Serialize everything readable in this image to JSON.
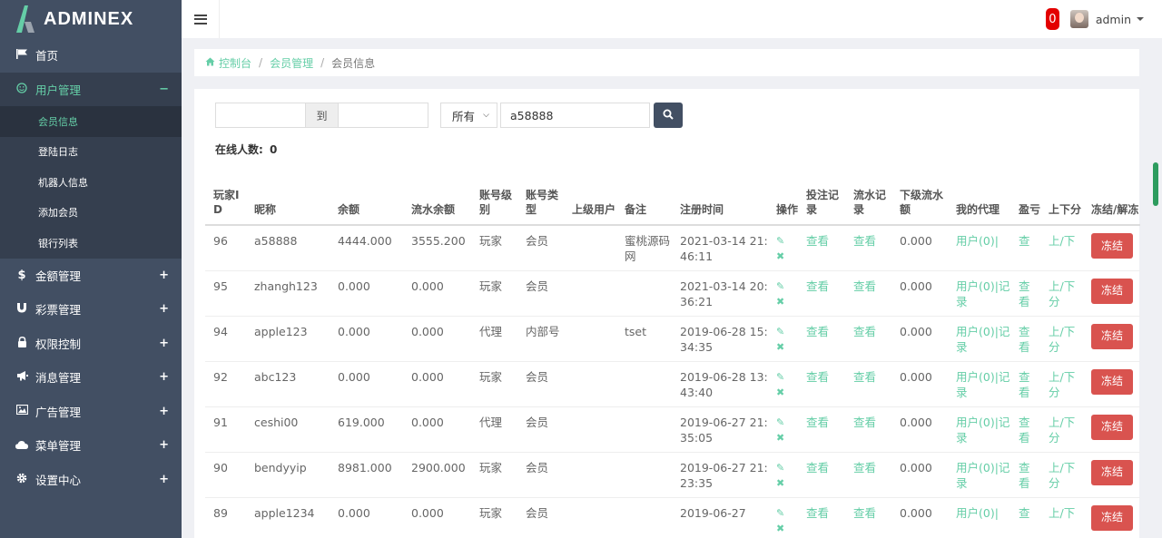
{
  "brand": {
    "name": "ADMINEX"
  },
  "sidebar": {
    "items": [
      {
        "label": "首页",
        "toggle": ""
      },
      {
        "label": "用户管理",
        "toggle": "−"
      },
      {
        "label": "金额管理",
        "toggle": "+"
      },
      {
        "label": "彩票管理",
        "toggle": "+"
      },
      {
        "label": "权限控制",
        "toggle": "+"
      },
      {
        "label": "消息管理",
        "toggle": "+"
      },
      {
        "label": "广告管理",
        "toggle": "+"
      },
      {
        "label": "菜单管理",
        "toggle": "+"
      },
      {
        "label": "设置中心",
        "toggle": "+"
      }
    ],
    "subitems": [
      "会员信息",
      "登陆日志",
      "机器人信息",
      "添加会员",
      "银行列表"
    ]
  },
  "header": {
    "notifications": "0",
    "username": "admin"
  },
  "breadcrumb": {
    "home": "控制台",
    "parent": "会员管理",
    "current": "会员信息"
  },
  "search": {
    "date_from": "",
    "date_sep": "到",
    "date_to": "",
    "select_value": "所有",
    "keyword": "a58888"
  },
  "online": {
    "label": "在线人数:",
    "value": "0"
  },
  "table": {
    "headers": [
      "玩家ID",
      "昵称",
      "余额",
      "流水余额",
      "账号级别",
      "账号类型",
      "上级用户",
      "备注",
      "注册时间",
      "操作",
      "投注记录",
      "流水记录",
      "下级流水额",
      "我的代理",
      "盈亏",
      "上下分",
      "冻结/解冻"
    ],
    "rows": [
      {
        "id": "96",
        "nick": "a58888",
        "balance": "4444.000",
        "flow": "3555.200",
        "level": "玩家",
        "type": "会员",
        "parent": "",
        "remark": "蜜桃源码网",
        "reg": "2021-03-14 21:46:11",
        "bet": "查看",
        "flowrec": "查看",
        "subflow": "0.000",
        "agent": "用户(0)|",
        "pl": "查",
        "updown": "上/下",
        "freeze": "冻结"
      },
      {
        "id": "95",
        "nick": "zhangh123",
        "balance": "0.000",
        "flow": "0.000",
        "level": "玩家",
        "type": "会员",
        "parent": "",
        "remark": "",
        "reg": "2021-03-14 20:36:21",
        "bet": "查看",
        "flowrec": "查看",
        "subflow": "0.000",
        "agent": "用户(0)|记录",
        "pl": "查看",
        "updown": "上/下分",
        "freeze": "冻结"
      },
      {
        "id": "94",
        "nick": "apple123",
        "balance": "0.000",
        "flow": "0.000",
        "level": "代理",
        "type": "内部号",
        "parent": "",
        "remark": "tset",
        "reg": "2019-06-28 15:34:35",
        "bet": "查看",
        "flowrec": "查看",
        "subflow": "0.000",
        "agent": "用户(0)|记录",
        "pl": "查看",
        "updown": "上/下分",
        "freeze": "冻结"
      },
      {
        "id": "92",
        "nick": "abc123",
        "balance": "0.000",
        "flow": "0.000",
        "level": "玩家",
        "type": "会员",
        "parent": "",
        "remark": "",
        "reg": "2019-06-28 13:43:40",
        "bet": "查看",
        "flowrec": "查看",
        "subflow": "0.000",
        "agent": "用户(0)|记录",
        "pl": "查看",
        "updown": "上/下分",
        "freeze": "冻结"
      },
      {
        "id": "91",
        "nick": "ceshi00",
        "balance": "619.000",
        "flow": "0.000",
        "level": "代理",
        "type": "会员",
        "parent": "",
        "remark": "",
        "reg": "2019-06-27 21:35:05",
        "bet": "查看",
        "flowrec": "查看",
        "subflow": "0.000",
        "agent": "用户(0)|记录",
        "pl": "查看",
        "updown": "上/下分",
        "freeze": "冻结"
      },
      {
        "id": "90",
        "nick": "bendyyip",
        "balance": "8981.000",
        "flow": "2900.000",
        "level": "玩家",
        "type": "会员",
        "parent": "",
        "remark": "",
        "reg": "2019-06-27 21:23:35",
        "bet": "查看",
        "flowrec": "查看",
        "subflow": "0.000",
        "agent": "用户(0)|记录",
        "pl": "查看",
        "updown": "上/下分",
        "freeze": "冻结"
      },
      {
        "id": "89",
        "nick": "apple1234",
        "balance": "0.000",
        "flow": "0.000",
        "level": "玩家",
        "type": "会员",
        "parent": "",
        "remark": "",
        "reg": "2019-06-27",
        "bet": "查看",
        "flowrec": "查看",
        "subflow": "0.000",
        "agent": "用户(0)|",
        "pl": "查",
        "updown": "上/下",
        "freeze": "冻结"
      }
    ]
  },
  "colors": {
    "sidebar": "#424f63",
    "accent": "#65cea7",
    "danger": "#d9534f",
    "badge": "#e30000"
  }
}
